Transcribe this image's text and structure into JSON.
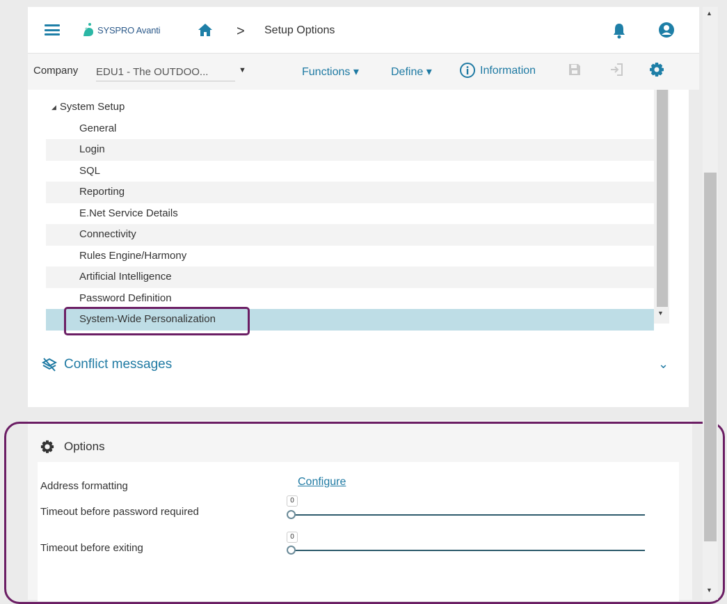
{
  "header": {
    "logo_text": "SYSPRO Avanti",
    "breadcrumb_separator": ">",
    "breadcrumb_current": "Setup Options"
  },
  "toolbar": {
    "company_label": "Company",
    "company_value": "EDU1 - The OUTDOO...",
    "functions": "Functions ▾",
    "define": "Define ▾",
    "information": "Information"
  },
  "tree": {
    "parent": "System Setup",
    "items": [
      "General",
      "Login",
      "SQL",
      "Reporting",
      "E.Net Service Details",
      "Connectivity",
      "Rules Engine/Harmony",
      "Artificial Intelligence",
      "Password Definition",
      "System-Wide Personalization"
    ],
    "selected_index": 9
  },
  "conflict": {
    "label": "Conflict messages"
  },
  "options": {
    "title": "Options",
    "address_label": "Address formatting",
    "configure_link": "Configure",
    "password_timeout_label": "Timeout before password required",
    "password_timeout_value": "0",
    "exit_timeout_label": "Timeout before exiting",
    "exit_timeout_value": "0"
  },
  "colors": {
    "accent": "#1f7aa3",
    "selected_row": "#bedde6",
    "annotation": "#6b1e64"
  }
}
